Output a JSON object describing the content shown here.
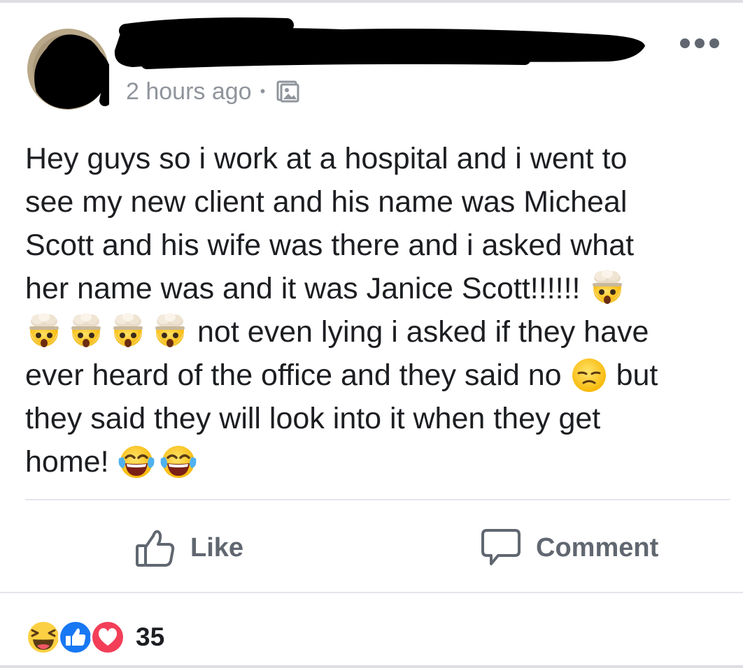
{
  "post": {
    "timestamp": "2 hours ago",
    "separator": "•",
    "audience_icon": "photo-album-icon",
    "more_icon": "more-options-icon",
    "text_lines": [
      "Hey guys so i work at a hospital and i went to",
      "see my new client and his name was Micheal",
      "Scott and his wife was there and i asked what",
      "her name was and it was Janice Scott!!!!!!",
      "not even lying i asked if they have",
      "ever heard of the office and they said no",
      "but",
      "they said they will look into it when they get",
      "home!"
    ],
    "emojis": {
      "mind_blown": "exploding-head-emoji",
      "disappointed": "pensive-face-emoji",
      "laughing": "tears-of-joy-emoji"
    }
  },
  "actions": {
    "like_label": "Like",
    "like_icon": "thumbs-up-icon",
    "comment_label": "Comment",
    "comment_icon": "speech-bubble-icon"
  },
  "reactions": {
    "icons": [
      "haha-reaction-icon",
      "like-reaction-icon",
      "love-reaction-icon"
    ],
    "count": "35"
  },
  "colors": {
    "text": "#1c1e21",
    "meta": "#90949c",
    "action": "#606770",
    "like_blue": "#1877f2",
    "love_red": "#f33e58",
    "haha_yellow": "#fcd043"
  }
}
